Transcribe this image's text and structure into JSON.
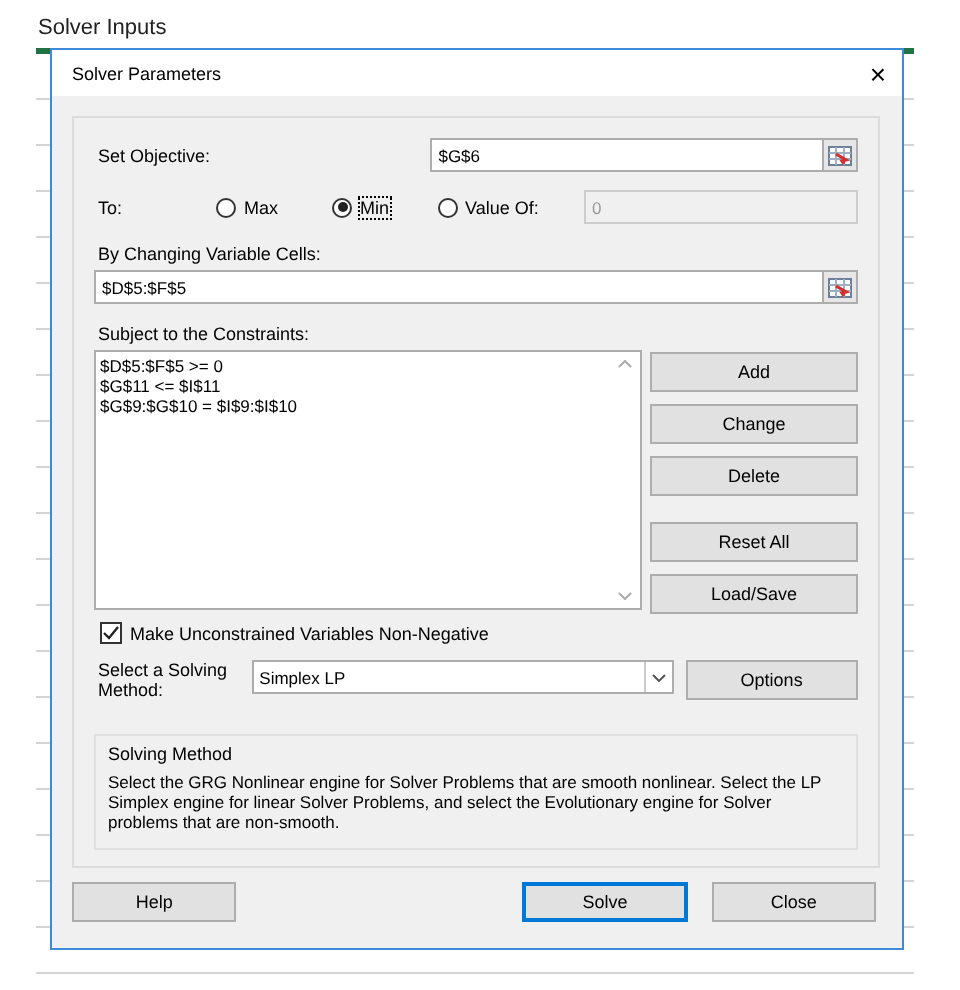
{
  "page_title": "Solver Inputs",
  "dialog": {
    "title": "Solver Parameters",
    "close": "×"
  },
  "objective": {
    "label": "Set Objective:",
    "value": "$G$6"
  },
  "to": {
    "label": "To:",
    "options": [
      {
        "label": "Max",
        "selected": false
      },
      {
        "label": "Min",
        "selected": true
      },
      {
        "label": "Value Of:",
        "selected": false
      }
    ],
    "value_field": {
      "value": "0",
      "disabled": true
    }
  },
  "changing_cells": {
    "label": "By Changing Variable Cells:",
    "value": "$D$5:$F$5"
  },
  "constraints": {
    "label": "Subject to the Constraints:",
    "items": [
      "$D$5:$F$5 >= 0",
      "$G$11 <= $I$11",
      "$G$9:$G$10 = $I$9:$I$10"
    ]
  },
  "constraint_buttons": [
    [
      "Add",
      "Change",
      "Delete"
    ],
    [
      "Reset All",
      "Load/Save"
    ]
  ],
  "non_negative": {
    "label": "Make Unconstrained Variables Non-Negative",
    "checked": true
  },
  "method": {
    "label": "Select a Solving Method:",
    "value": "Simplex LP",
    "options_button": "Options"
  },
  "method_info": {
    "title": "Solving Method",
    "text": "Select the GRG Nonlinear engine for Solver Problems that are smooth nonlinear. Select the LP Simplex engine for linear Solver Problems, and select the Evolutionary engine for Solver problems that are non-smooth."
  },
  "footer_buttons": [
    {
      "label": "Help",
      "default": false
    },
    {
      "label": "Solve",
      "default": true
    },
    {
      "label": "Close",
      "default": false
    }
  ]
}
